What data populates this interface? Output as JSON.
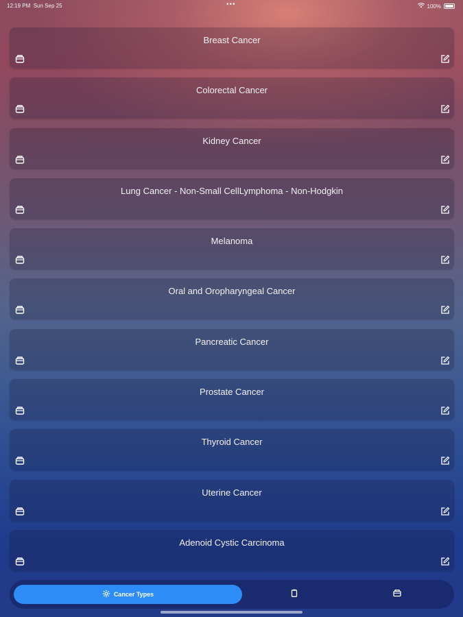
{
  "status_bar": {
    "time": "12:19 PM",
    "date": "Sun Sep 25",
    "dots": "•••",
    "battery": "100%"
  },
  "cards": [
    {
      "title": "Breast Cancer"
    },
    {
      "title": "Colorectal Cancer"
    },
    {
      "title": "Kidney Cancer"
    },
    {
      "title": "Lung Cancer - Non-Small CellLymphoma - Non-Hodgkin"
    },
    {
      "title": "Melanoma"
    },
    {
      "title": "Oral and Oropharyngeal Cancer"
    },
    {
      "title": "Pancreatic Cancer"
    },
    {
      "title": "Prostate Cancer"
    },
    {
      "title": "Thyroid Cancer"
    },
    {
      "title": "Uterine Cancer"
    },
    {
      "title": "Adenoid Cystic Carcinoma"
    }
  ],
  "card_icons": {
    "left": "archive-box-icon",
    "right": "edit-icon"
  },
  "tabbar": {
    "active_label": "Cancer Types",
    "active_icon": "gear-icon",
    "tab2_icon": "clipboard-icon",
    "tab3_icon": "archive-box-icon",
    "active_color": "#2e8cf6"
  }
}
